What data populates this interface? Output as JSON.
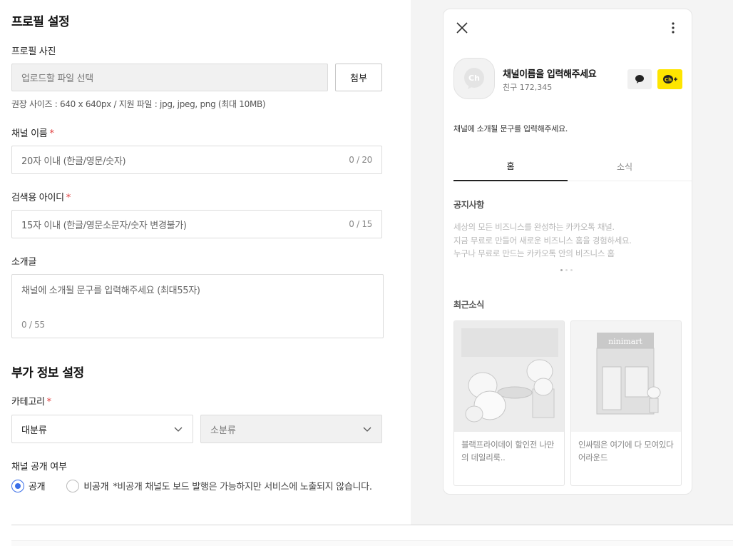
{
  "profile_section": {
    "title": "프로필 설정",
    "photo_label": "프로필 사진",
    "photo_placeholder": "업로드할 파일 선택",
    "attach_button": "첨부",
    "photo_hint": "권장 사이즈 : 640 x 640px / 지원 파일 : jpg, jpeg, png (최대 10MB)",
    "channel_name_label": "채널 이름",
    "channel_name_placeholder": "20자 이내 (한글/영문/숫자)",
    "channel_name_counter": "0 / 20",
    "search_id_label": "검색용 아이디",
    "search_id_placeholder": "15자 이내 (한글/영문소문자/숫자 변경불가)",
    "search_id_counter": "0 / 15",
    "intro_label": "소개글",
    "intro_placeholder": "채널에 소개될 문구를 입력해주세요 (최대55자)",
    "intro_counter": "0 / 55",
    "required_mark": "*"
  },
  "extra_section": {
    "title": "부가 정보 설정",
    "category_label": "카테고리",
    "category_main": "대분류",
    "category_sub": "소분류",
    "visibility_label": "채널 공개 여부",
    "public_label": "공개",
    "private_label": "비공개",
    "private_note": "*비공개 채널도 보드 발행은 가능하지만 서비스에 노출되지 않습니다.",
    "selected": "공개"
  },
  "preview": {
    "channel_name": "채널이름을 입력해주세요",
    "friends": "친구 172,345",
    "intro": "채널에 소개될 문구를 입력해주세요.",
    "tabs": [
      "홈",
      "소식"
    ],
    "active_tab": "홈",
    "notice_title": "공지사항",
    "notice_lines": [
      "세상의 모든 비즈니스를 완성하는 카카오톡 채널.",
      "지금 무료로 만들어 새로운 비즈니스 홈을 경험하세요.",
      "누구나 무료로 만드는 카카오톡 안의 비즈니스 홈"
    ],
    "recent_title": "최근소식",
    "news": [
      {
        "text": "블랙프라이데이 할인전 나만의 데일리룩.."
      },
      {
        "text": "인싸템은 여기에 다 모여있다 어라운드",
        "sign": "ninimart"
      }
    ],
    "logo_text": "Ch",
    "accent_color": "#fee500"
  },
  "icons": {
    "close": "close-icon",
    "more": "more-vertical-icon",
    "chat": "chat-bubble-icon",
    "add_friend": "add-channel-icon",
    "chevron": "chevron-down-icon"
  }
}
